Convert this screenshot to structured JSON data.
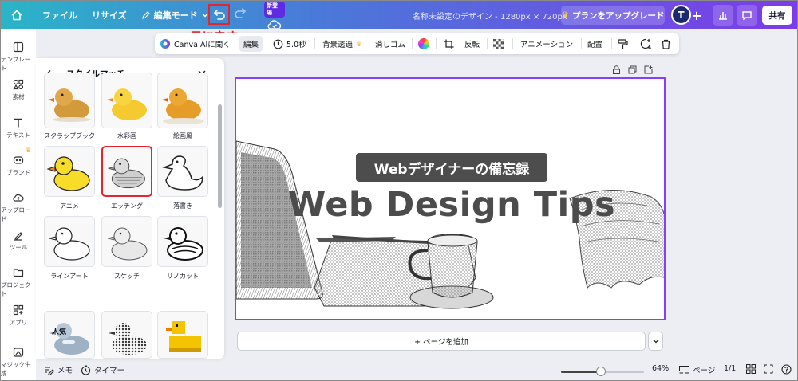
{
  "topbar": {
    "file": "ファイル",
    "resize": "リサイズ",
    "edit_mode": "編集モード",
    "new_badge": "新登場",
    "doc_title": "名称未設定のデザイン - 1280px × 720px",
    "upgrade": "プランをアップグレード",
    "avatar_initial": "T",
    "share": "共有"
  },
  "annotation": {
    "undo_note": "元に戻す"
  },
  "rail": [
    {
      "label": "テンプレート",
      "icon": "template-icon"
    },
    {
      "label": "素材",
      "icon": "elements-icon"
    },
    {
      "label": "テキスト",
      "icon": "text-icon"
    },
    {
      "label": "ブランド",
      "icon": "brand-icon"
    },
    {
      "label": "アップロード",
      "icon": "upload-icon"
    },
    {
      "label": "ツール",
      "icon": "tools-icon"
    },
    {
      "label": "プロジェクト",
      "icon": "folder-icon"
    },
    {
      "label": "アプリ",
      "icon": "apps-icon"
    },
    {
      "label": "マジック生成",
      "icon": "magic-icon"
    }
  ],
  "panel": {
    "title": "スタイルマッチ",
    "styles": [
      {
        "label": "スクラップブック"
      },
      {
        "label": "水彩画"
      },
      {
        "label": "絵画風"
      },
      {
        "label": "アニメ"
      },
      {
        "label": "エッチング"
      },
      {
        "label": "落書き"
      },
      {
        "label": "ラインアート"
      },
      {
        "label": "スケッチ"
      },
      {
        "label": "リノカット"
      }
    ],
    "popular_heading": "人気"
  },
  "toolbar": {
    "canva_ai": "Canva AIに聞く",
    "edit": "編集",
    "duration": "5.0秒",
    "bg_remove": "背景透過",
    "eraser": "消しゴム",
    "flip": "反転",
    "animation": "アニメーション",
    "arrange": "配置"
  },
  "canvas": {
    "subtitle": "Webデザイナーの備忘録",
    "title": "Web Design Tips"
  },
  "add_page": "+ ページを追加",
  "bottombar": {
    "memo": "メモ",
    "timer": "タイマー",
    "zoom": "64%",
    "zoom_fraction": 0.64,
    "pages_label": "ページ",
    "page_count": "1/1"
  },
  "colors": {
    "accent": "#8b3dff",
    "highlight": "#e2262b",
    "topbar_start": "#2ab5c7",
    "topbar_end": "#7d3be8"
  }
}
